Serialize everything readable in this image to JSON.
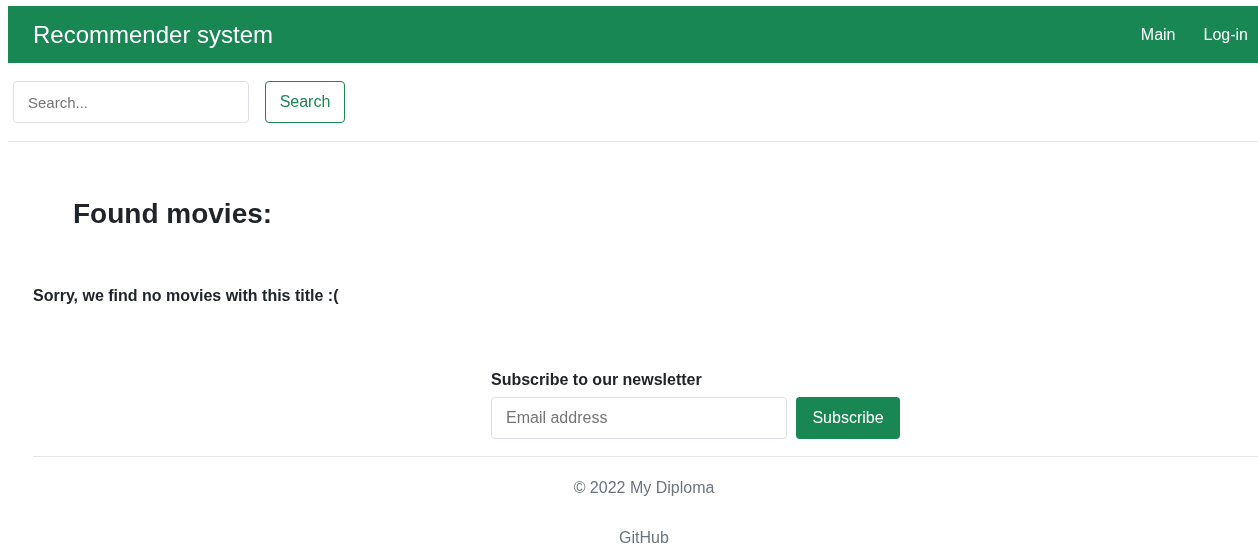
{
  "navbar": {
    "brand": "Recommender system",
    "links": [
      "Main",
      "Log-in"
    ]
  },
  "search": {
    "placeholder": "Search...",
    "button": "Search"
  },
  "results": {
    "heading": "Found movies:",
    "message": "Sorry, we find no movies with this title :("
  },
  "newsletter": {
    "label": "Subscribe to our newsletter",
    "placeholder": "Email address",
    "button": "Subscribe"
  },
  "footer": {
    "copyright": "© 2022 My Diploma",
    "link": "GitHub"
  }
}
